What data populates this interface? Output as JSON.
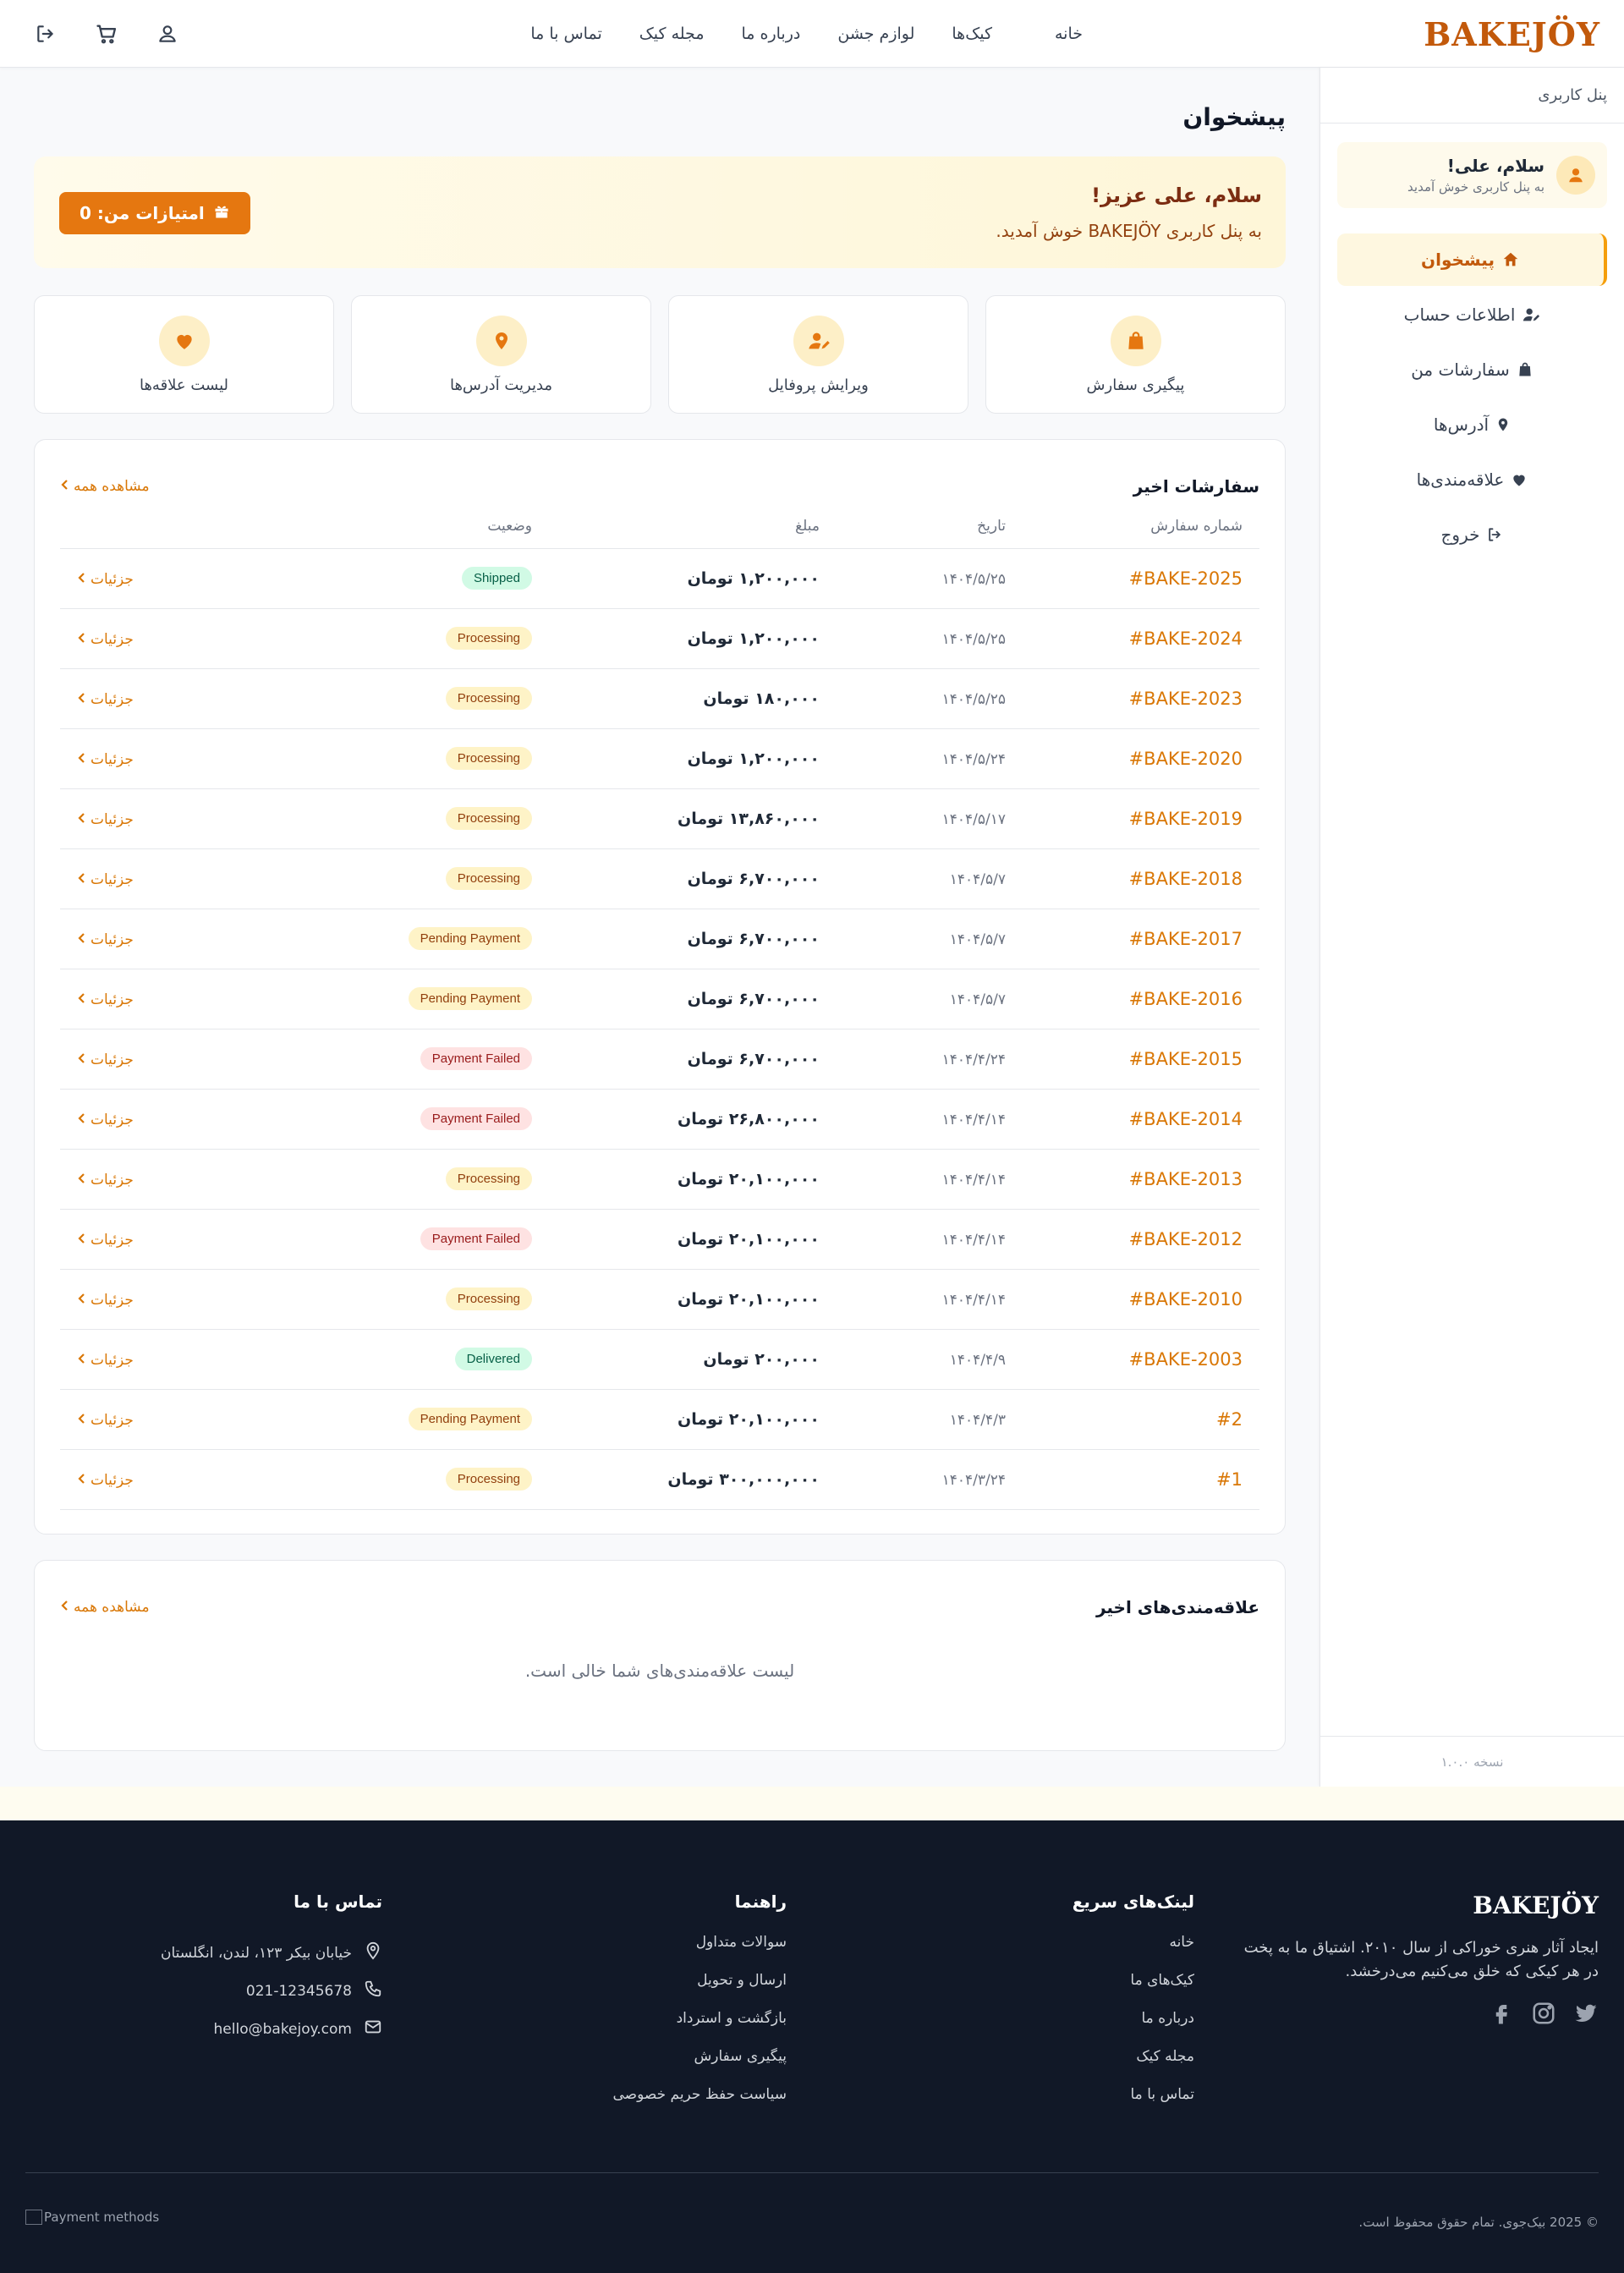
{
  "header": {
    "logo": "BAKEJÖY",
    "nav": [
      "خانه",
      "کیک‌ها",
      "لوازم جشن",
      "درباره ما",
      "مجله کیک",
      "تماس با ما"
    ],
    "icons": [
      "logout-icon",
      "cart-icon",
      "user-icon"
    ]
  },
  "sidebar": {
    "title": "پنل کاربری",
    "user_name": "سلام، علی!",
    "user_sub": "به پنل کاربری خوش آمدید",
    "items": [
      {
        "label": "پیشخوان",
        "icon": "home-icon",
        "active": true
      },
      {
        "label": "اطلاعات حساب",
        "icon": "user-edit-icon",
        "active": false
      },
      {
        "label": "سفارشات من",
        "icon": "bag-icon",
        "active": false
      },
      {
        "label": "آدرس‌ها",
        "icon": "location-icon",
        "active": false
      },
      {
        "label": "علاقه‌مندی‌ها",
        "icon": "heart-icon",
        "active": false
      },
      {
        "label": "خروج",
        "icon": "logout-icon",
        "active": false
      }
    ],
    "version": "نسخه ۱.۰.۰"
  },
  "main": {
    "page_title": "پیشخوان",
    "welcome": {
      "title": "سلام، علی عزیز!",
      "subtitle": "به پنل کاربری BAKEJÖY خوش آمدید.",
      "points_label": "امتیازات من: 0"
    },
    "quick_links": [
      {
        "label": "پیگیری سفارش",
        "icon": "bag-icon"
      },
      {
        "label": "ویرایش پروفایل",
        "icon": "user-edit-icon"
      },
      {
        "label": "مدیریت آدرس‌ها",
        "icon": "location-icon"
      },
      {
        "label": "لیست علاقه‌ها",
        "icon": "heart-icon"
      }
    ],
    "orders": {
      "title": "سفارشات اخیر",
      "view_all": "مشاهده همه",
      "columns": [
        "شماره سفارش",
        "تاریخ",
        "مبلغ",
        "وضعیت"
      ],
      "details_label": "جزئیات",
      "rows": [
        {
          "id": "#BAKE-2025",
          "date": "۱۴۰۴/۵/۲۵",
          "amount": "۱,۲۰۰,۰۰۰ تومان",
          "status": "Shipped",
          "kind": "shipped"
        },
        {
          "id": "#BAKE-2024",
          "date": "۱۴۰۴/۵/۲۵",
          "amount": "۱,۲۰۰,۰۰۰ تومان",
          "status": "Processing",
          "kind": "processing"
        },
        {
          "id": "#BAKE-2023",
          "date": "۱۴۰۴/۵/۲۵",
          "amount": "۱۸۰,۰۰۰ تومان",
          "status": "Processing",
          "kind": "processing"
        },
        {
          "id": "#BAKE-2020",
          "date": "۱۴۰۴/۵/۲۴",
          "amount": "۱,۲۰۰,۰۰۰ تومان",
          "status": "Processing",
          "kind": "processing"
        },
        {
          "id": "#BAKE-2019",
          "date": "۱۴۰۴/۵/۱۷",
          "amount": "۱۳,۸۶۰,۰۰۰ تومان",
          "status": "Processing",
          "kind": "processing"
        },
        {
          "id": "#BAKE-2018",
          "date": "۱۴۰۴/۵/۷",
          "amount": "۶,۷۰۰,۰۰۰ تومان",
          "status": "Processing",
          "kind": "processing"
        },
        {
          "id": "#BAKE-2017",
          "date": "۱۴۰۴/۵/۷",
          "amount": "۶,۷۰۰,۰۰۰ تومان",
          "status": "Pending Payment",
          "kind": "pending"
        },
        {
          "id": "#BAKE-2016",
          "date": "۱۴۰۴/۵/۷",
          "amount": "۶,۷۰۰,۰۰۰ تومان",
          "status": "Pending Payment",
          "kind": "pending"
        },
        {
          "id": "#BAKE-2015",
          "date": "۱۴۰۴/۴/۲۴",
          "amount": "۶,۷۰۰,۰۰۰ تومان",
          "status": "Payment Failed",
          "kind": "failed"
        },
        {
          "id": "#BAKE-2014",
          "date": "۱۴۰۴/۴/۱۴",
          "amount": "۲۶,۸۰۰,۰۰۰ تومان",
          "status": "Payment Failed",
          "kind": "failed"
        },
        {
          "id": "#BAKE-2013",
          "date": "۱۴۰۴/۴/۱۴",
          "amount": "۲۰,۱۰۰,۰۰۰ تومان",
          "status": "Processing",
          "kind": "processing"
        },
        {
          "id": "#BAKE-2012",
          "date": "۱۴۰۴/۴/۱۴",
          "amount": "۲۰,۱۰۰,۰۰۰ تومان",
          "status": "Payment Failed",
          "kind": "failed"
        },
        {
          "id": "#BAKE-2010",
          "date": "۱۴۰۴/۴/۱۴",
          "amount": "۲۰,۱۰۰,۰۰۰ تومان",
          "status": "Processing",
          "kind": "processing"
        },
        {
          "id": "#BAKE-2003",
          "date": "۱۴۰۴/۴/۹",
          "amount": "۲۰۰,۰۰۰ تومان",
          "status": "Delivered",
          "kind": "delivered"
        },
        {
          "id": "#2",
          "date": "۱۴۰۴/۴/۳",
          "amount": "۲۰,۱۰۰,۰۰۰ تومان",
          "status": "Pending Payment",
          "kind": "pending"
        },
        {
          "id": "#1",
          "date": "۱۴۰۴/۳/۲۴",
          "amount": "۳۰۰,۰۰۰,۰۰۰ تومان",
          "status": "Processing",
          "kind": "processing"
        }
      ]
    },
    "favorites": {
      "title": "علاقه‌مندی‌های اخیر",
      "view_all": "مشاهده همه",
      "empty": "لیست علاقه‌مندی‌های شما خالی است."
    }
  },
  "footer": {
    "logo": "BAKEJÖY",
    "description": "ایجاد آثار هنری خوراکی از سال ۲۰۱۰. اشتیاق ما به پخت در هر کیکی که خلق می‌کنیم می‌درخشد.",
    "social": [
      "twitter-icon",
      "instagram-icon",
      "facebook-icon"
    ],
    "quick_links_title": "لینک‌های سریع",
    "quick_links": [
      "خانه",
      "کیک‌های ما",
      "درباره ما",
      "مجله کیک",
      "تماس با ما"
    ],
    "guide_title": "راهنما",
    "guide_links": [
      "سوالات متداول",
      "ارسال و تحویل",
      "بازگشت و استرداد",
      "پیگیری سفارش",
      "سیاست حفظ حریم خصوصی"
    ],
    "contact_title": "تماس با ما",
    "contact": [
      {
        "icon": "location-icon",
        "text": "خیابان بیکر ۱۲۳، لندن، انگلستان"
      },
      {
        "icon": "phone-icon",
        "text": "021-12345678"
      },
      {
        "icon": "mail-icon",
        "text": "hello@bakejoy.com"
      }
    ],
    "copyright": "© 2025 بیک‌جوی. تمام حقوق محفوظ است.",
    "payment_alt": "Payment methods"
  }
}
